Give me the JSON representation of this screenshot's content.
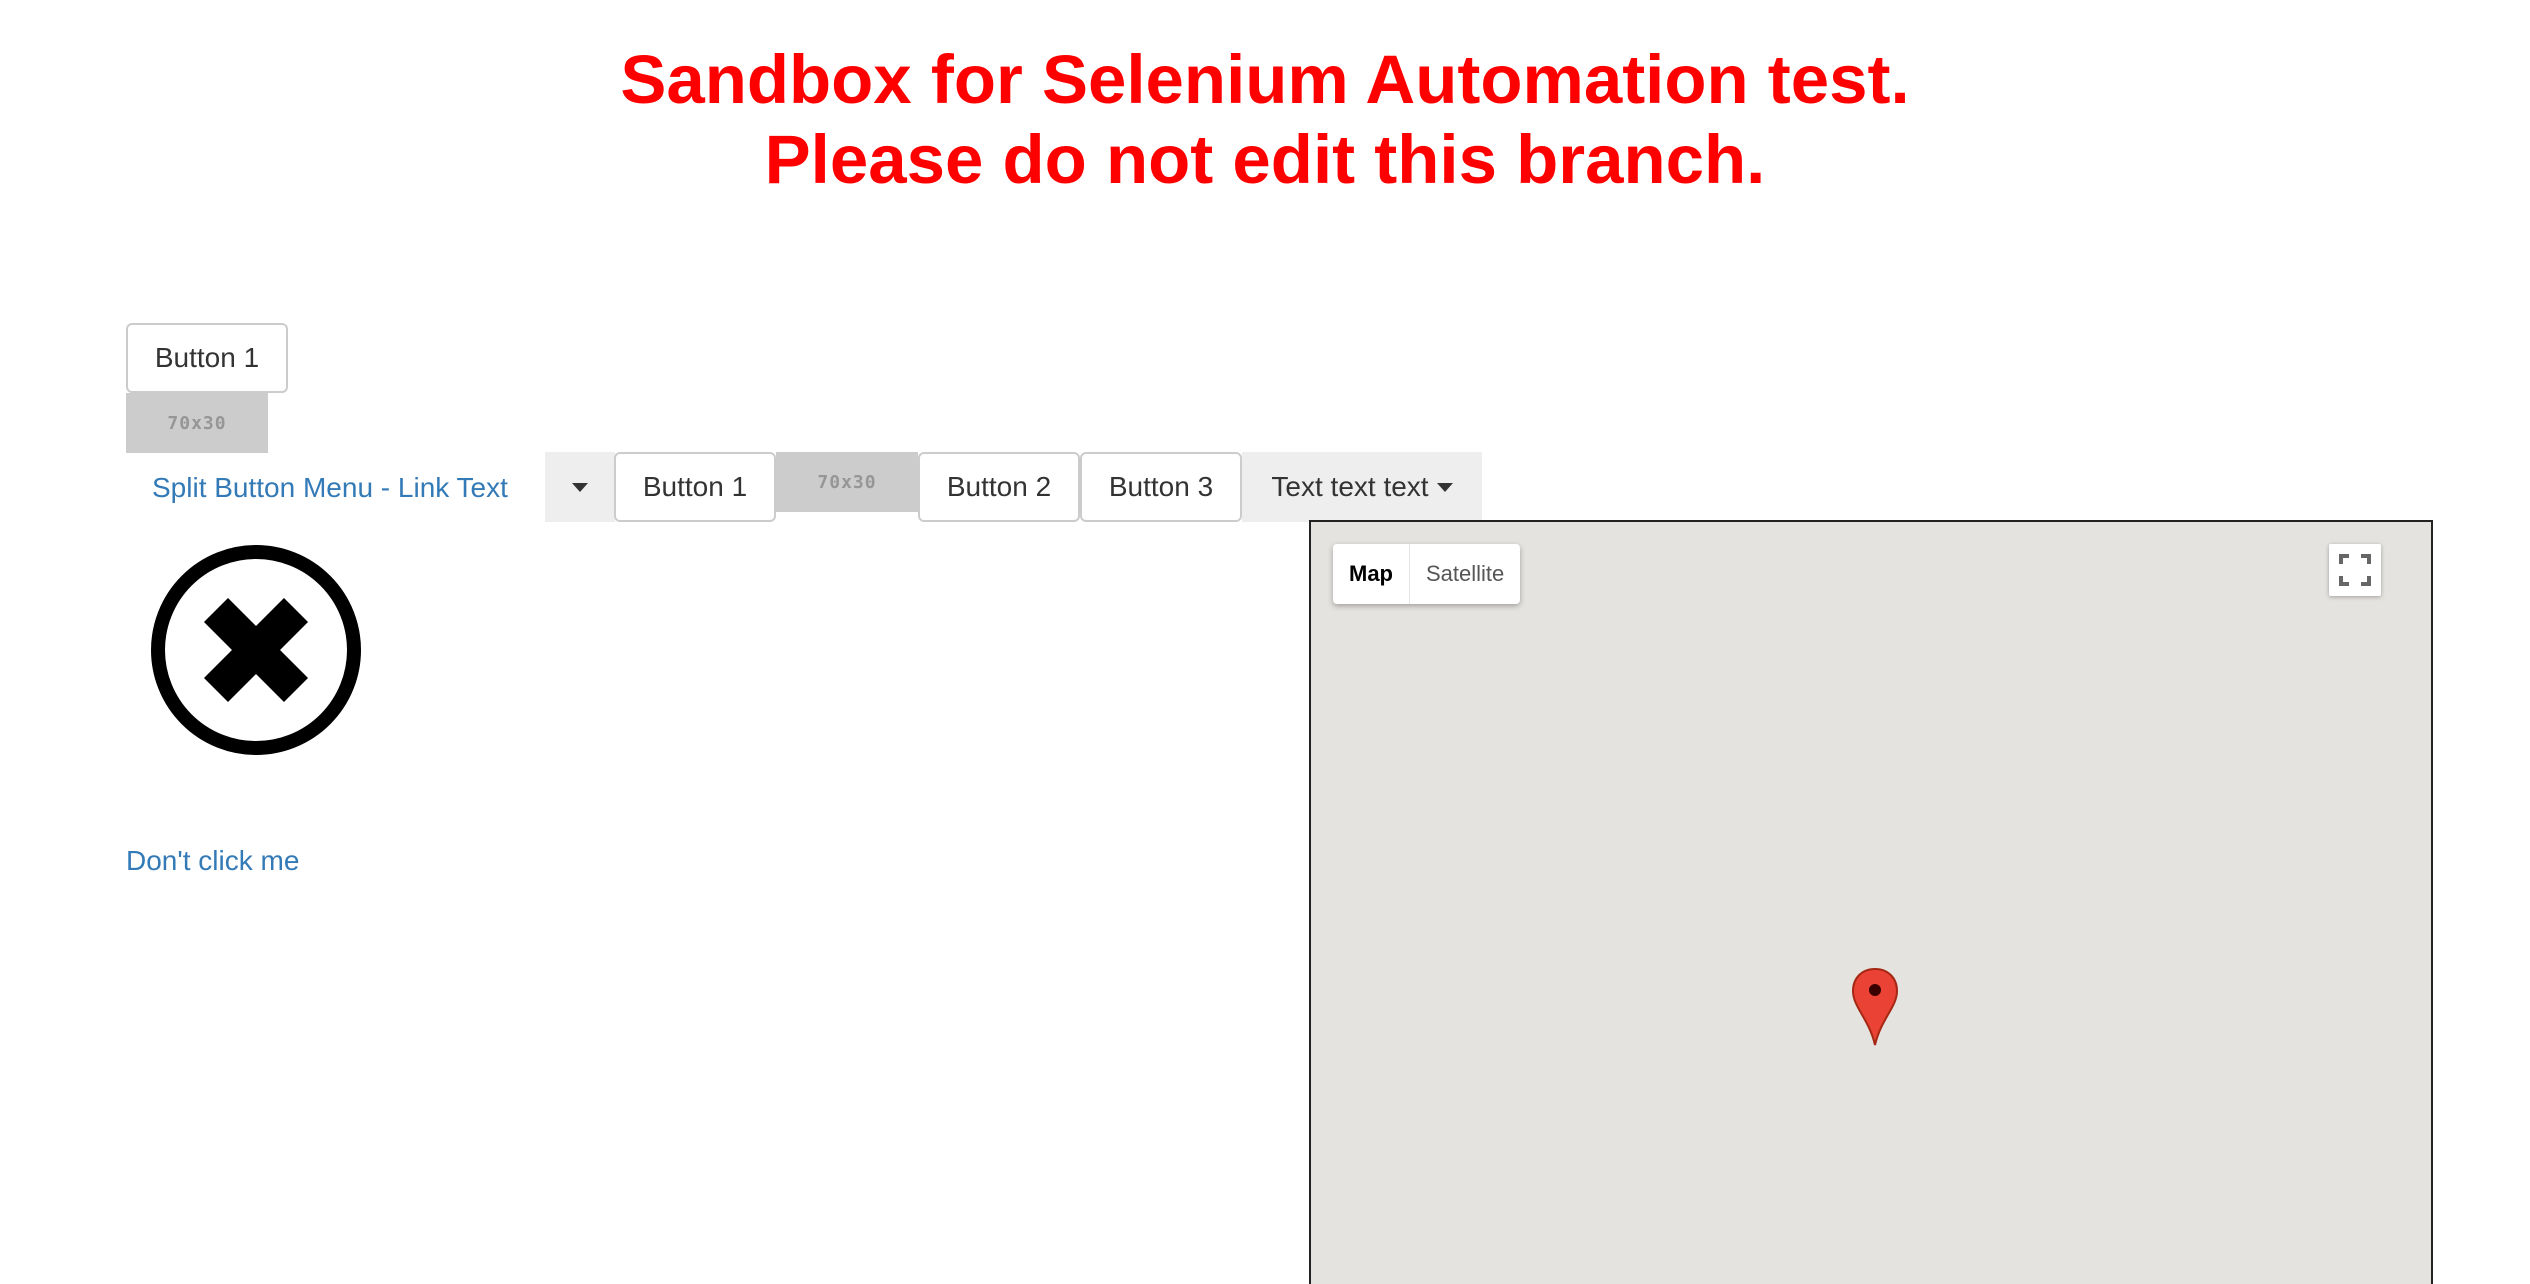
{
  "header": {
    "line1": "Sandbox for Selenium Automation test.",
    "line2": "Please do not edit this branch."
  },
  "top_button": {
    "label": "Button 1"
  },
  "placeholder_image": {
    "label": "70x30"
  },
  "split_button": {
    "link_text": "Split Button Menu - Link Text"
  },
  "button_group": {
    "button1": "Button 1",
    "placeholder": "70x30",
    "button2": "Button 2",
    "button3": "Button 3"
  },
  "text_dropdown": {
    "label": "Text text text"
  },
  "dont_click_link": {
    "label": "Don't click me"
  },
  "map": {
    "map_label": "Map",
    "satellite_label": "Satellite",
    "selected": "Map"
  },
  "colors": {
    "header": "#ff0000",
    "link": "#337ab7",
    "map_background": "#e5e3df",
    "marker": "#ea4335"
  },
  "icons": {
    "close": "close-circle-icon",
    "marker": "map-marker-icon",
    "fullscreen": "fullscreen-icon",
    "caret": "caret-down-icon"
  }
}
